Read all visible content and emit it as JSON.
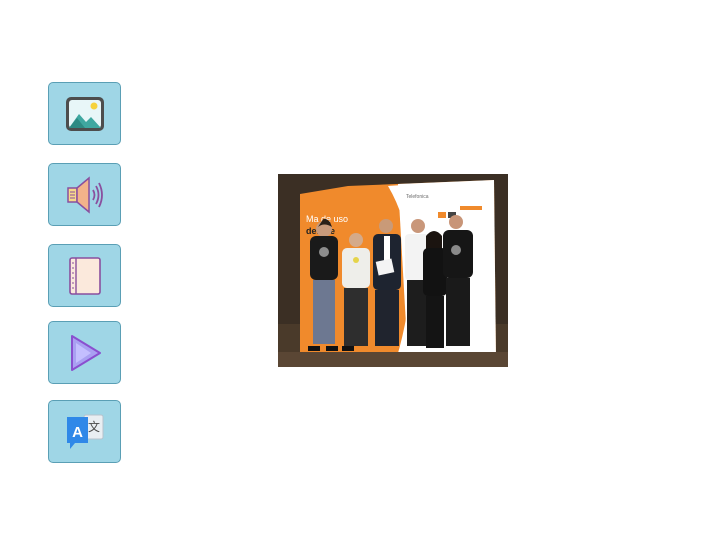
{
  "toolbar": {
    "buttons": [
      {
        "icon": "image-icon"
      },
      {
        "icon": "speaker-icon"
      },
      {
        "icon": "book-icon"
      },
      {
        "icon": "play-icon"
      },
      {
        "icon": "translate-icon",
        "glyph_a": "A",
        "glyph_b": "文"
      }
    ]
  },
  "photo": {
    "banner_brand": "Telefonica",
    "banner_heading_1": "Ma     de uso",
    "banner_heading_2": "del         are"
  },
  "colors": {
    "button_fill": "#9fd6e6",
    "button_border": "#5a9fb5",
    "banner_orange": "#f08a2c"
  }
}
